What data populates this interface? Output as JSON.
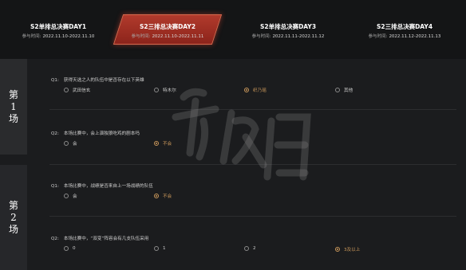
{
  "tabs": [
    {
      "title": "S2单排总决赛DAY1",
      "time_label": "参与时间:",
      "time": "2022.11.10-2022.11.10",
      "active": false
    },
    {
      "title": "S2三排总决赛DAY2",
      "time_label": "参与时间:",
      "time": "2022.11.10-2022.11.11",
      "active": true
    },
    {
      "title": "S2单排总决赛DAY3",
      "time_label": "参与时间:",
      "time": "2022.11.11-2022.11.12",
      "active": false
    },
    {
      "title": "S2三排总决赛DAY4",
      "time_label": "参与时间:",
      "time": "2022.11.12-2022.11.13",
      "active": false
    }
  ],
  "rounds": [
    {
      "label_lines": [
        "第",
        "1",
        "场"
      ]
    },
    {
      "label_lines": [
        "第",
        "2",
        "场"
      ]
    }
  ],
  "questions": [
    {
      "num": "Q1:",
      "text": "获得天选之人的队伍中是否存在以下英雄",
      "options": [
        "武田信玄",
        "特木尔",
        "织乃瑶",
        "其他"
      ],
      "selected": 2
    },
    {
      "num": "Q2:",
      "text": "本场比赛中，会上演独狼吃鸡的剧本吗",
      "options": [
        "会",
        "不会"
      ],
      "selected": 1
    },
    {
      "num": "Q1:",
      "text": "本场比赛中，战绩是否来自上一场战绩的队伍",
      "options": [
        "会",
        "不会"
      ],
      "selected": 1
    },
    {
      "num": "Q2:",
      "text": "本场比赛中，“双变”阵容会有几支队伍采用",
      "options": [
        "0",
        "1",
        "2",
        "3及以上"
      ],
      "selected": 3
    }
  ],
  "colors": {
    "accent": "#a8302a",
    "selected": "#c9975a",
    "background": "#1b1c1e"
  }
}
